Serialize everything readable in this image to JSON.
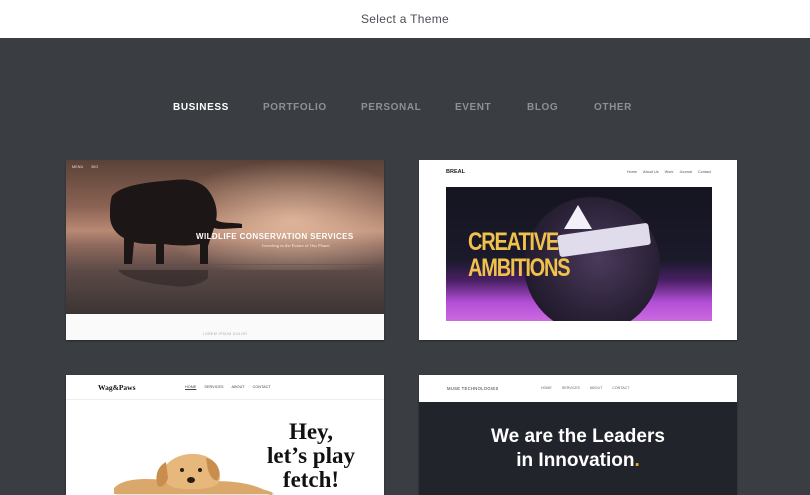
{
  "header": {
    "title": "Select a Theme"
  },
  "tabs": [
    {
      "label": "BUSINESS",
      "active": true
    },
    {
      "label": "PORTFOLIO",
      "active": false
    },
    {
      "label": "PERSONAL",
      "active": false
    },
    {
      "label": "EVENT",
      "active": false
    },
    {
      "label": "BLOG",
      "active": false
    },
    {
      "label": "OTHER",
      "active": false
    }
  ],
  "themes": [
    {
      "nav": [
        "MENU",
        "BIO"
      ],
      "headline": "WILDLIFE CONSERVATION SERVICES",
      "subheadline": "Investing in the Future of Our Planet",
      "footer": "LOREM IPSUM DOLOR"
    },
    {
      "brand": "BREAL",
      "nav": [
        "Home",
        "About Us",
        "Work",
        "Journal",
        "Contact"
      ],
      "headline_line1": "CREATIVE",
      "headline_line2": "AMBITIONS"
    },
    {
      "brand": "Wag&Paws",
      "nav": [
        "HOME",
        "SERVICES",
        "ABOUT",
        "CONTACT"
      ],
      "headline_line1": "Hey,",
      "headline_line2": "let’s play",
      "headline_line3": "fetch!"
    },
    {
      "brand": "MUSE TECHNOLOGIES",
      "nav": [
        "HOME",
        "SERVICES",
        "ABOUT",
        "CONTACT"
      ],
      "headline_line1": "We are the Leaders",
      "headline_line2": "in Innovation",
      "headline_dot": "."
    }
  ],
  "colors": {
    "background": "#3a3e42",
    "active_tab": "#ffffff",
    "inactive_tab": "#8c9196",
    "accent_creative": "#f0c14b",
    "accent_dot": "#f0a832"
  }
}
